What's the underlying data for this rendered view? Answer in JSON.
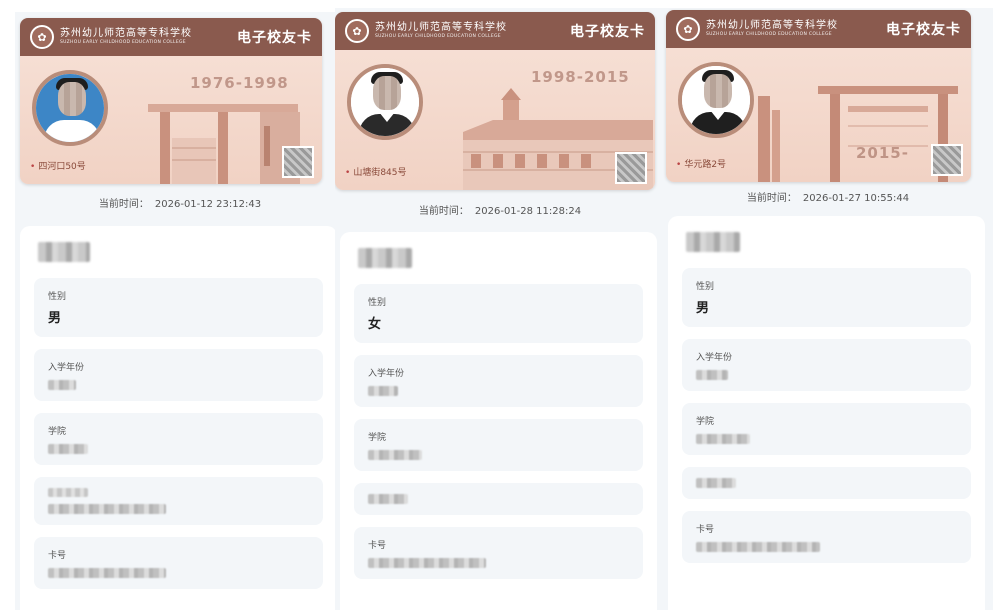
{
  "card": {
    "school_cn": "苏州幼儿师范高等专科学校",
    "school_en": "SUZHOU EARLY CHILDHOOD EDUCATION COLLEGE",
    "title": "电子校友卡",
    "logo_icon": "school-emblem-icon"
  },
  "time_label": "当前时间：",
  "labels": {
    "gender": "性别",
    "year": "入学年份",
    "college": "学院",
    "card_no": "卡号"
  },
  "phones": [
    {
      "years": "1976-1998",
      "address": "四河口50号",
      "current_time": "2026-01-12 23:12:43",
      "gender": "男",
      "avatar_bg": "#3d86c6",
      "avatar_body": "#ffffff"
    },
    {
      "years": "1998-2015",
      "address": "山塘街845号",
      "current_time": "2026-01-28 11:28:24",
      "gender": "女",
      "avatar_bg": "#ffffff",
      "avatar_body": "#2a2a2a"
    },
    {
      "years": "2015-",
      "address": "华元路2号",
      "current_time": "2026-01-27 10:55:44",
      "gender": "男",
      "avatar_bg": "#ffffff",
      "avatar_body": "#1f1f1f"
    }
  ],
  "colors": {
    "card_header": "#8a5a4e",
    "card_bg": "#f1d2c4",
    "page_bg": "#f3f6f9"
  }
}
